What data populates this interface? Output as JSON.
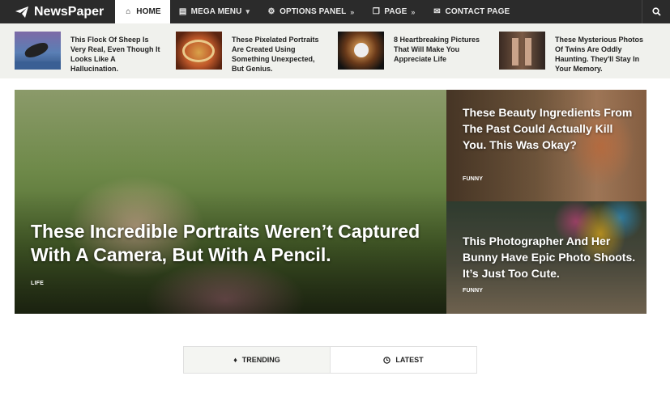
{
  "nav": {
    "brand": "NewsPaper",
    "items": [
      {
        "label": "HOME",
        "icon": "home-icon",
        "arrow": ""
      },
      {
        "label": "MEGA MENU",
        "icon": "newspaper-icon",
        "arrow": "▾"
      },
      {
        "label": "OPTIONS PANEL",
        "icon": "gear-icon",
        "arrow": "»"
      },
      {
        "label": "PAGE",
        "icon": "page-icon",
        "arrow": "»"
      },
      {
        "label": "CONTACT PAGE",
        "icon": "envelope-icon",
        "arrow": ""
      }
    ],
    "search_icon": "search-icon"
  },
  "ticker": [
    {
      "text": "This Flock Of Sheep Is Very Real, Even Though It Looks Like A Hallucination."
    },
    {
      "text": "These Pixelated Portraits Are Created Using Something Unexpected, But Genius."
    },
    {
      "text": "8 Heartbreaking Pictures That Will Make You Appreciate Life"
    },
    {
      "text": "These Mysterious Photos Of Twins Are Oddly Haunting. They'll Stay In Your Memory."
    }
  ],
  "featured": {
    "main": {
      "title": "These Incredible Portraits Weren’t Captured With A Camera, But With A Pencil.",
      "category": "LIFE"
    },
    "side": [
      {
        "title": "These Beauty Ingredients From The Past Could Actually Kill You. This Was Okay?",
        "category": "FUNNY"
      },
      {
        "title": "This Photographer And Her Bunny Have Epic Photo Shoots. It’s Just Too Cute.",
        "category": "FUNNY"
      }
    ]
  },
  "tabs": [
    {
      "label": "TRENDING",
      "icon": "flame-icon"
    },
    {
      "label": "LATEST",
      "icon": "clock-icon"
    }
  ],
  "colors": {
    "nav_bg": "#2b2b2b",
    "strip_bg": "#f0f1ed",
    "tab_active_bg": "#f4f5f2"
  }
}
